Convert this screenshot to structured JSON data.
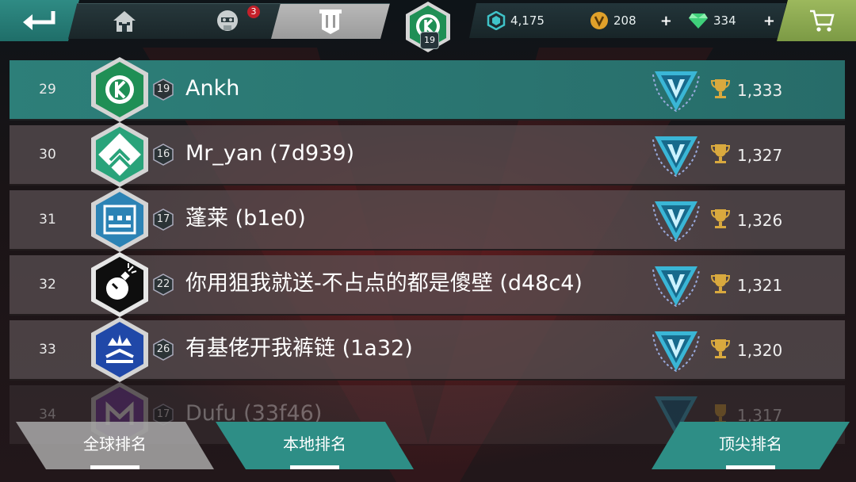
{
  "topbar": {
    "notification_count": "3",
    "player_level": "19",
    "resources": [
      {
        "name": "credits",
        "value": "4,175",
        "icon": "hexagon-credit-icon",
        "color": "#3fc3c8"
      },
      {
        "name": "gold",
        "value": "208",
        "icon": "gold-coin-icon",
        "color": "#e0a12a",
        "has_plus": true
      },
      {
        "name": "gems",
        "value": "334",
        "icon": "gem-icon",
        "color": "#3fcf7a",
        "has_plus": true
      }
    ]
  },
  "leaderboard": {
    "rows": [
      {
        "rank": "29",
        "level": "19",
        "name": "Ankh",
        "score": "1,333",
        "avatar": "teal-k-emblem",
        "highlight": true
      },
      {
        "rank": "30",
        "level": "16",
        "name": "Mr_yan (7d939)",
        "score": "1,327",
        "avatar": "teal-chevron-emblem"
      },
      {
        "rank": "31",
        "level": "17",
        "name": "蓬莱 (b1e0)",
        "score": "1,326",
        "avatar": "blue-fortress-emblem"
      },
      {
        "rank": "32",
        "level": "22",
        "name": "你用狙我就送-不占点的都是傻壁 (d48c4)",
        "score": "1,321",
        "avatar": "bomb-emblem"
      },
      {
        "rank": "33",
        "level": "26",
        "name": "有基佬开我裤链 (1a32)",
        "score": "1,320",
        "avatar": "crown-emblem"
      },
      {
        "rank": "34",
        "level": "17",
        "name": "Dufu (33f46)",
        "score": "1,317",
        "avatar": "purple-m-emblem",
        "faded": true
      }
    ]
  },
  "bottom_tabs": [
    {
      "label": "全球排名",
      "active": false
    },
    {
      "label": "本地排名",
      "active": true
    },
    {
      "label": "顶尖排名",
      "active": true
    }
  ],
  "colors": {
    "accent_teal": "#2d7f79",
    "row_gray": "#5c5254",
    "cart_green": "#8aa84f"
  }
}
